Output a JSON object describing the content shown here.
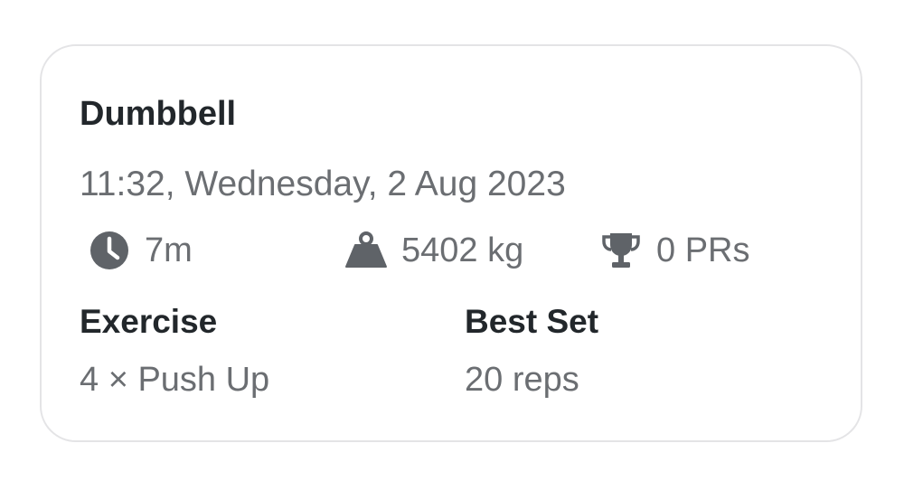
{
  "workout": {
    "title": "Dumbbell",
    "datetime": "11:32, Wednesday, 2 Aug 2023",
    "stats": {
      "duration": {
        "icon": "clock-icon",
        "value": "7m"
      },
      "volume": {
        "icon": "weight-icon",
        "value": "5402 kg"
      },
      "prs": {
        "icon": "trophy-icon",
        "value": "0 PRs"
      }
    },
    "columns": {
      "exercise_header": "Exercise",
      "best_set_header": "Best Set"
    },
    "rows": [
      {
        "exercise": "4 × Push Up",
        "best_set": "20 reps"
      }
    ]
  },
  "colors": {
    "title_text": "#22272b",
    "secondary_text": "#6b6e72",
    "icon": "#5f6368",
    "card_border": "#e4e4e6"
  }
}
